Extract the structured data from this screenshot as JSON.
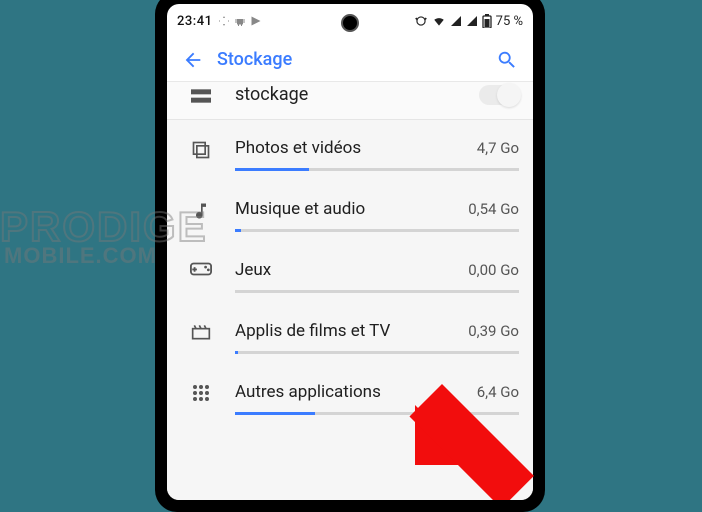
{
  "status": {
    "time": "23:41",
    "battery_text": "75 %"
  },
  "appbar": {
    "title": "Stockage"
  },
  "partial_row": {
    "label": "stockage"
  },
  "categories": [
    {
      "label": "Photos et vidéos",
      "size": "4,7 Go",
      "fill_pct": 26
    },
    {
      "label": "Musique et audio",
      "size": "0,54 Go",
      "fill_pct": 2
    },
    {
      "label": "Jeux",
      "size": "0,00 Go",
      "fill_pct": 0
    },
    {
      "label": "Applis de films et TV",
      "size": "0,39 Go",
      "fill_pct": 1
    },
    {
      "label": "Autres applications",
      "size": "6,4 Go",
      "fill_pct": 28
    }
  ],
  "watermark": {
    "line1": "PRODIGE",
    "line2": "MOBILE.COM"
  }
}
